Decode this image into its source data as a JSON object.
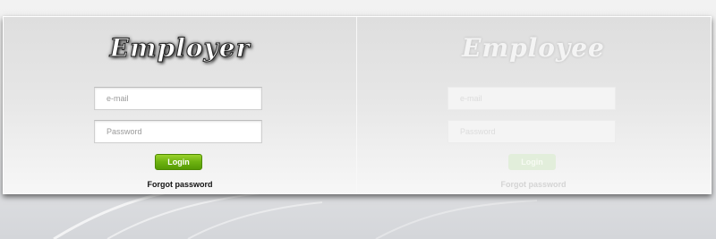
{
  "employer": {
    "title": "Employer",
    "email_placeholder": "e-mail",
    "password_placeholder": "Password",
    "login_label": "Login",
    "forgot_label": "Forgot password"
  },
  "employee": {
    "title": "Employee",
    "email_placeholder": "e-mail",
    "password_placeholder": "Password",
    "login_label": "Login",
    "forgot_label": "Forgot password"
  },
  "colors": {
    "login_button": "#6db210",
    "inactive_button": "#e2eedb"
  }
}
